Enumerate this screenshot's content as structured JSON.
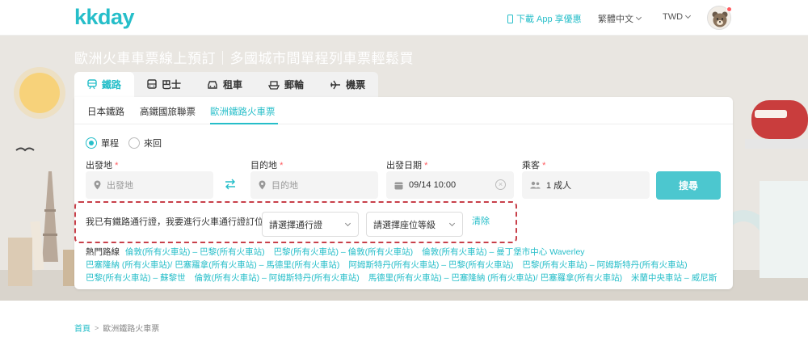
{
  "header": {
    "logo": "kkday",
    "app_link": "下載 App 享優惠",
    "language": "繁體中文",
    "currency": "TWD"
  },
  "hero": {
    "title": "歐洲火車車票線上預訂｜多國城市間單程列車票輕鬆買"
  },
  "tabs": [
    {
      "label": "鐵路",
      "icon": "train-icon"
    },
    {
      "label": "巴士",
      "icon": "bus-icon"
    },
    {
      "label": "租車",
      "icon": "car-icon"
    },
    {
      "label": "郵輪",
      "icon": "ship-icon"
    },
    {
      "label": "機票",
      "icon": "plane-icon"
    }
  ],
  "subtabs": [
    "日本鐵路",
    "高鐵國旅聯票",
    "歐洲鐵路火車票"
  ],
  "trip_type": {
    "one_way": "單程",
    "round_trip": "來回",
    "selected": "單程"
  },
  "form": {
    "from_label": "出發地",
    "from_placeholder": "出發地",
    "to_label": "目的地",
    "to_placeholder": "目的地",
    "date_label": "出發日期",
    "date_value": "09/14 10:00",
    "pax_label": "乘客",
    "pax_value": "1 成人",
    "required_mark": "*",
    "search": "搜尋"
  },
  "pass": {
    "text": "我已有鐵路通行證，我要進行火車通行證訂位",
    "pass_select": "請選擇通行證",
    "class_select": "請選擇座位等級",
    "clear": "清除"
  },
  "hot_routes": {
    "label": "熱門路線",
    "routes": [
      "倫敦(所有火車站) – 巴黎(所有火車站)",
      "巴黎(所有火車站) – 倫敦(所有火車站)",
      "倫敦(所有火車站) – 曼丁堡市中心 Waverley",
      "巴塞隆納 (所有火車站)/ 巴塞羅拿(所有火車站) – 馬德里(所有火車站)",
      "阿姆斯特丹(所有火車站) – 巴黎(所有火車站)",
      "巴黎(所有火車站) – 阿姆斯特丹(所有火車站)",
      "巴黎(所有火車站) – 蘇黎世",
      "倫敦(所有火車站) – 阿姆斯特丹(所有火車站)",
      "馬德里(所有火車站) – 巴塞隆納 (所有火車站)/ 巴塞羅拿(所有火車站)",
      "米蘭中央車站 – 威尼斯"
    ]
  },
  "breadcrumb": {
    "home": "首頁",
    "separator": ">",
    "current": "歐洲鐵路火車票"
  },
  "colors": {
    "accent": "#26bec9",
    "required": "#ff5a5f",
    "dashed_highlight": "#c8404a"
  }
}
